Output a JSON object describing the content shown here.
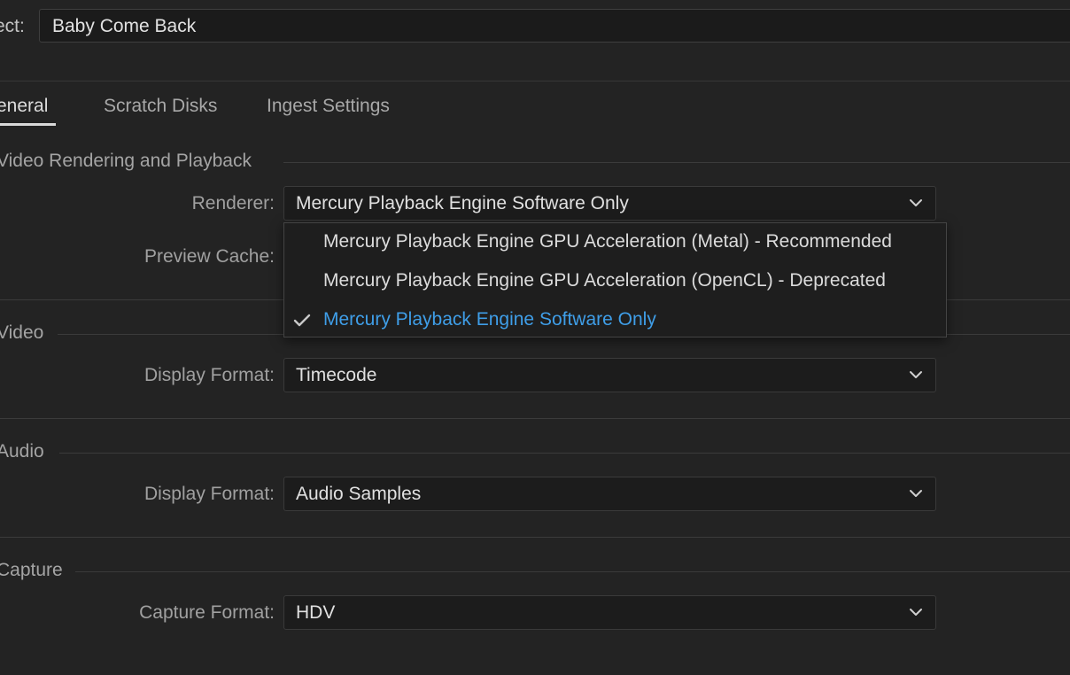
{
  "project": {
    "label": "ect:",
    "value": "Baby Come Back"
  },
  "tabs": [
    {
      "label": "eneral",
      "active": true
    },
    {
      "label": "Scratch Disks",
      "active": false
    },
    {
      "label": "Ingest Settings",
      "active": false
    }
  ],
  "sections": {
    "rendering": {
      "title": "Video Rendering and Playback",
      "renderer_label": "Renderer:",
      "renderer_value": "Mercury Playback Engine Software Only",
      "preview_cache_label": "Preview Cache:"
    },
    "video": {
      "title": "Video",
      "display_format_label": "Display Format:",
      "display_format_value": "Timecode"
    },
    "audio": {
      "title": "Audio",
      "display_format_label": "Display Format:",
      "display_format_value": "Audio Samples"
    },
    "capture": {
      "title": "Capture",
      "capture_format_label": "Capture Format:",
      "capture_format_value": "HDV"
    }
  },
  "renderer_menu": {
    "items": [
      {
        "label": "Mercury Playback Engine GPU Acceleration (Metal) - Recommended",
        "selected": false
      },
      {
        "label": "Mercury Playback Engine GPU Acceleration (OpenCL) - Deprecated",
        "selected": false
      },
      {
        "label": "Mercury Playback Engine Software Only",
        "selected": true
      }
    ]
  },
  "colors": {
    "background": "#232323",
    "accent_selected": "#3f9ee8",
    "field_bg": "#1c1c1c"
  },
  "icons": {
    "dropdown": "chevron-down-icon",
    "selected": "checkmark-icon"
  }
}
